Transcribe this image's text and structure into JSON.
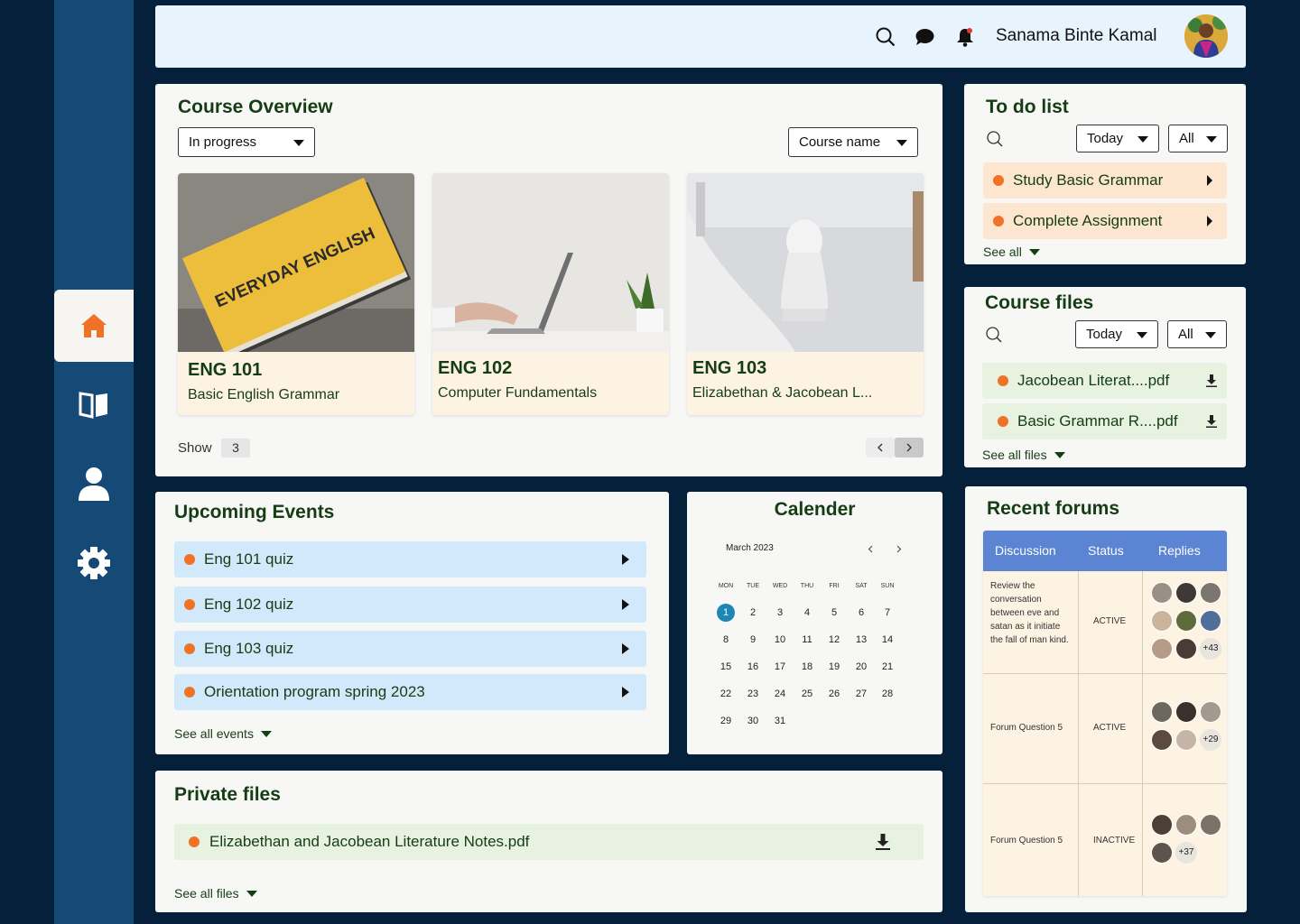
{
  "header": {
    "user_name": "Sanama Binte Kamal",
    "icons": [
      "search-icon",
      "chat-icon",
      "bell-icon"
    ]
  },
  "sidebar": {
    "items": [
      {
        "name": "home",
        "icon": "home-icon",
        "active": true
      },
      {
        "name": "library",
        "icon": "book-icon",
        "active": false
      },
      {
        "name": "profile",
        "icon": "user-icon",
        "active": false
      },
      {
        "name": "settings",
        "icon": "gear-icon",
        "active": false
      }
    ]
  },
  "course_overview": {
    "title": "Course Overview",
    "filter": "In progress",
    "sort": "Course name",
    "show_label": "Show",
    "show_count": "3",
    "courses": [
      {
        "code": "ENG 101",
        "name": "Basic English Grammar",
        "image": "everyday-english-book",
        "book_title": "EVERYDAY ENGLISH"
      },
      {
        "code": "ENG 102",
        "name": "Computer Fundamentals",
        "image": "laptop-typing"
      },
      {
        "code": "ENG 103",
        "name": "Elizabethan & Jacobean L...",
        "image": "bust-statue"
      }
    ]
  },
  "todo": {
    "title": "To do list",
    "filter_date": "Today",
    "filter_type": "All",
    "items": [
      "Study Basic Grammar",
      "Complete Assignment"
    ],
    "see_all": "See all"
  },
  "course_files": {
    "title": "Course files",
    "filter_date": "Today",
    "filter_type": "All",
    "files": [
      "Jacobean Literat....pdf",
      "Basic Grammar R....pdf"
    ],
    "see_all": "See all files"
  },
  "events": {
    "title": "Upcoming Events",
    "items": [
      "Eng 101 quiz",
      "Eng 102 quiz",
      "Eng 103 quiz",
      "Orientation program spring 2023"
    ],
    "see_all": "See all events"
  },
  "calendar": {
    "title": "Calender",
    "month": "March 2023",
    "weekdays": [
      "MON",
      "TUE",
      "WED",
      "THU",
      "FRI",
      "SAT",
      "SUN"
    ],
    "days": [
      "1",
      "2",
      "3",
      "4",
      "5",
      "6",
      "7",
      "8",
      "9",
      "10",
      "11",
      "12",
      "13",
      "14",
      "15",
      "16",
      "17",
      "18",
      "19",
      "20",
      "21",
      "22",
      "23",
      "24",
      "25",
      "26",
      "27",
      "28",
      "29",
      "30",
      "31"
    ],
    "selected": "1"
  },
  "private_files": {
    "title": "Private files",
    "files": [
      "Elizabethan and Jacobean Literature Notes.pdf"
    ],
    "see_all": "See all files"
  },
  "forums": {
    "title": "Recent forums",
    "columns": [
      "Discussion",
      "Status",
      "Replies"
    ],
    "rows": [
      {
        "discussion": "Review the conversation between eve and satan as it initiate the fall of man kind.",
        "status": "ACTIVE",
        "more": "+43"
      },
      {
        "discussion": "Forum Question 5",
        "status": "ACTIVE",
        "more": "+29"
      },
      {
        "discussion": "Forum Question 5",
        "status": "INACTIVE",
        "more": "+37"
      }
    ]
  },
  "colors": {
    "navy": "#05203a",
    "sidebar": "#164a76",
    "accent_orange": "#f07226",
    "text_green": "#153d14",
    "event_blue": "#d1e9fb",
    "todo_peach": "#fde6cf",
    "file_green": "#e7f2e1",
    "forum_header": "#5b84d2"
  }
}
